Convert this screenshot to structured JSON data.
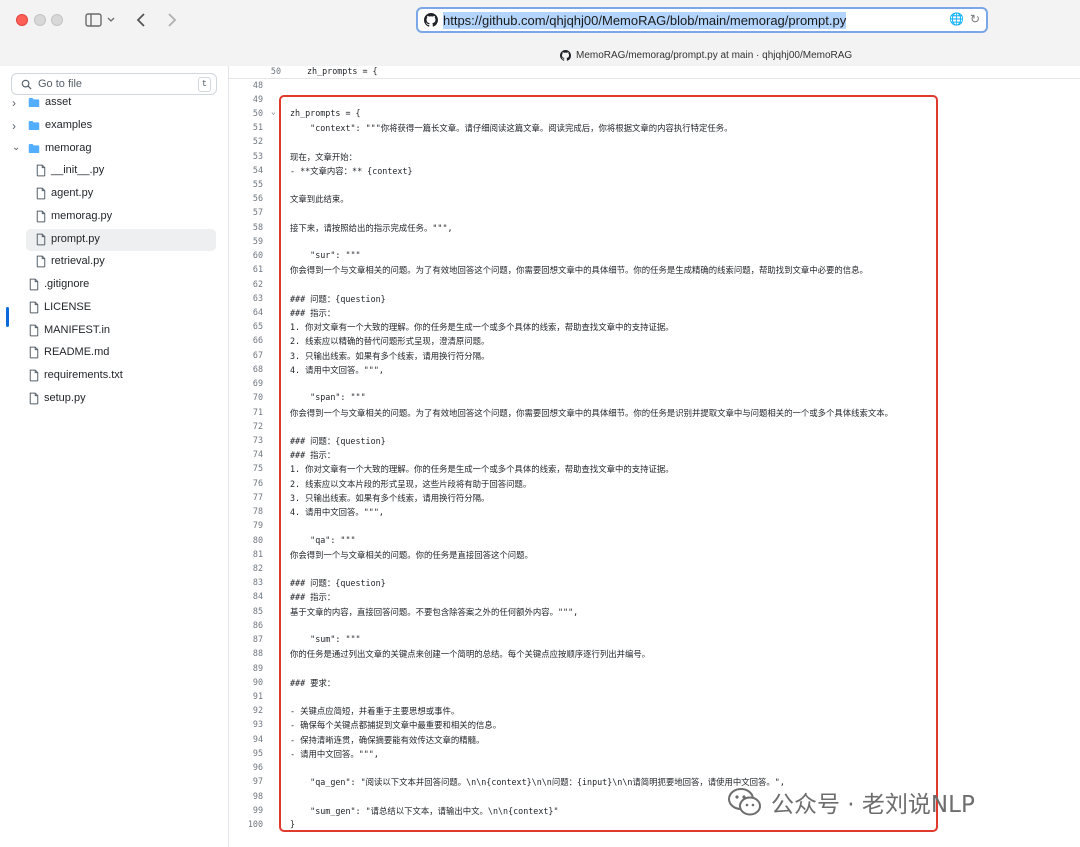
{
  "browser": {
    "url": "https://github.com/qhjqhj00/MemoRAG/blob/main/memorag/prompt.py",
    "tab_title": "MemoRAG/memorag/prompt.py at main · qhjqhj00/MemoRAG"
  },
  "sidebar": {
    "search_placeholder": "Go to file",
    "search_shortcut": "t",
    "items": [
      {
        "label": "asset",
        "type": "folder",
        "expanded": false
      },
      {
        "label": "examples",
        "type": "folder",
        "expanded": false
      },
      {
        "label": "memorag",
        "type": "folder",
        "expanded": true
      },
      {
        "label": "__init__.py",
        "type": "file"
      },
      {
        "label": "agent.py",
        "type": "file"
      },
      {
        "label": "memorag.py",
        "type": "file"
      },
      {
        "label": "prompt.py",
        "type": "file",
        "active": true
      },
      {
        "label": "retrieval.py",
        "type": "file"
      },
      {
        "label": ".gitignore",
        "type": "file"
      },
      {
        "label": "LICENSE",
        "type": "file"
      },
      {
        "label": "MANIFEST.in",
        "type": "file"
      },
      {
        "label": "README.md",
        "type": "file"
      },
      {
        "label": "requirements.txt",
        "type": "file"
      },
      {
        "label": "setup.py",
        "type": "file"
      }
    ]
  },
  "code": {
    "sticky": {
      "n": "50",
      "text": "zh_prompts = {"
    },
    "lines": [
      {
        "n": "48",
        "text": ""
      },
      {
        "n": "49",
        "text": ""
      },
      {
        "n": "50",
        "text": "zh_prompts = {"
      },
      {
        "n": "51",
        "text": "    \"context\": \"\"\"你将获得一篇长文章。请仔细阅读这篇文章。阅读完成后，你将根据文章的内容执行特定任务。"
      },
      {
        "n": "52",
        "text": ""
      },
      {
        "n": "53",
        "text": "现在，文章开始："
      },
      {
        "n": "54",
        "text": "- **文章内容：** {context}"
      },
      {
        "n": "55",
        "text": ""
      },
      {
        "n": "56",
        "text": "文章到此结束。"
      },
      {
        "n": "57",
        "text": ""
      },
      {
        "n": "58",
        "text": "接下来，请按照给出的指示完成任务。\"\"\","
      },
      {
        "n": "59",
        "text": ""
      },
      {
        "n": "60",
        "text": "    \"sur\": \"\"\""
      },
      {
        "n": "61",
        "text": "你会得到一个与文章相关的问题。为了有效地回答这个问题，你需要回想文章中的具体细节。你的任务是生成精确的线索问题，帮助找到文章中必要的信息。"
      },
      {
        "n": "62",
        "text": ""
      },
      {
        "n": "63",
        "text": "### 问题：{question}"
      },
      {
        "n": "64",
        "text": "### 指示："
      },
      {
        "n": "65",
        "text": "1. 你对文章有一个大致的理解。你的任务是生成一个或多个具体的线索，帮助查找文章中的支持证据。"
      },
      {
        "n": "66",
        "text": "2. 线索应以精确的替代问题形式呈现，澄清原问题。"
      },
      {
        "n": "67",
        "text": "3. 只输出线索。如果有多个线索，请用换行符分隔。"
      },
      {
        "n": "68",
        "text": "4. 请用中文回答。\"\"\","
      },
      {
        "n": "69",
        "text": ""
      },
      {
        "n": "70",
        "text": "    \"span\": \"\"\""
      },
      {
        "n": "71",
        "text": "你会得到一个与文章相关的问题。为了有效地回答这个问题，你需要回想文章中的具体细节。你的任务是识别并提取文章中与问题相关的一个或多个具体线索文本。"
      },
      {
        "n": "72",
        "text": ""
      },
      {
        "n": "73",
        "text": "### 问题：{question}"
      },
      {
        "n": "74",
        "text": "### 指示："
      },
      {
        "n": "75",
        "text": "1. 你对文章有一个大致的理解。你的任务是生成一个或多个具体的线索，帮助查找文章中的支持证据。"
      },
      {
        "n": "76",
        "text": "2. 线索应以文本片段的形式呈现，这些片段将有助于回答问题。"
      },
      {
        "n": "77",
        "text": "3. 只输出线索。如果有多个线索，请用换行符分隔。"
      },
      {
        "n": "78",
        "text": "4. 请用中文回答。\"\"\","
      },
      {
        "n": "79",
        "text": ""
      },
      {
        "n": "80",
        "text": "    \"qa\": \"\"\""
      },
      {
        "n": "81",
        "text": "你会得到一个与文章相关的问题。你的任务是直接回答这个问题。"
      },
      {
        "n": "82",
        "text": ""
      },
      {
        "n": "83",
        "text": "### 问题：{question}"
      },
      {
        "n": "84",
        "text": "### 指示："
      },
      {
        "n": "85",
        "text": "基于文章的内容，直接回答问题。不要包含除答案之外的任何额外内容。\"\"\","
      },
      {
        "n": "86",
        "text": ""
      },
      {
        "n": "87",
        "text": "    \"sum\": \"\"\""
      },
      {
        "n": "88",
        "text": "你的任务是通过列出文章的关键点来创建一个简明的总结。每个关键点应按顺序逐行列出并编号。"
      },
      {
        "n": "89",
        "text": ""
      },
      {
        "n": "90",
        "text": "### 要求："
      },
      {
        "n": "91",
        "text": ""
      },
      {
        "n": "92",
        "text": "- 关键点应简短，并着重于主要思想或事件。"
      },
      {
        "n": "93",
        "text": "- 确保每个关键点都捕捉到文章中最重要和相关的信息。"
      },
      {
        "n": "94",
        "text": "- 保持清晰连贯，确保摘要能有效传达文章的精髓。"
      },
      {
        "n": "95",
        "text": "- 请用中文回答。\"\"\","
      },
      {
        "n": "96",
        "text": ""
      },
      {
        "n": "97",
        "text": "    \"qa_gen\": \"阅读以下文本并回答问题。\\n\\n{context}\\n\\n问题：{input}\\n\\n请简明扼要地回答，请使用中文回答。\","
      },
      {
        "n": "98",
        "text": ""
      },
      {
        "n": "99",
        "text": "    \"sum_gen\": \"请总结以下文本，请输出中文。\\n\\n{context}\""
      },
      {
        "n": "100",
        "text": "}"
      }
    ]
  },
  "watermark": {
    "text": "公众号 · 老刘说NLP"
  },
  "colors": {
    "accent": "#0969da",
    "highlight_border": "#e03a2f",
    "close": "#fe5f57"
  }
}
